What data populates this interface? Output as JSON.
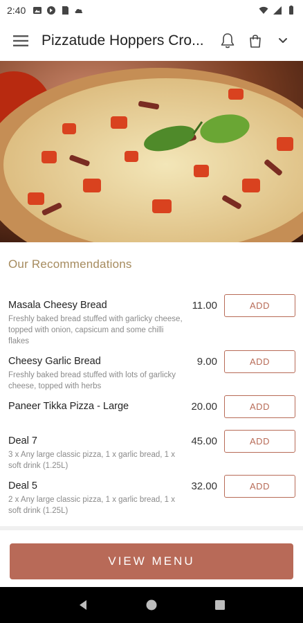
{
  "status_bar": {
    "time": "2:40"
  },
  "app_bar": {
    "title": "Pizzatude Hoppers Cro..."
  },
  "section": {
    "title": "Our Recommendations"
  },
  "items": [
    {
      "name": "Masala Cheesy Bread",
      "description": "Freshly baked bread stuffed with garlicky cheese, topped with onion, capsicum and some chilli flakes",
      "price": "11.00",
      "add_label": "ADD"
    },
    {
      "name": "Cheesy Garlic Bread",
      "description": "Freshly baked bread stuffed with lots of garlicky cheese, topped with herbs",
      "price": "9.00",
      "add_label": "ADD"
    },
    {
      "name": "Paneer Tikka Pizza - Large",
      "description": "",
      "price": "20.00",
      "add_label": "ADD"
    },
    {
      "name": "Deal 7",
      "description": "3 x Any large classic pizza, 1 x garlic bread, 1 x soft drink (1.25L)",
      "price": "45.00",
      "add_label": "ADD"
    },
    {
      "name": "Deal 5",
      "description": "2 x Any large classic pizza, 1 x garlic bread, 1 x soft drink (1.25L)",
      "price": "32.00",
      "add_label": "ADD"
    }
  ],
  "view_menu_label": "VIEW MENU",
  "colors": {
    "accent": "#b86a58",
    "section_title": "#a68b5e"
  },
  "icons": {
    "menu": "hamburger-icon",
    "bell": "bell-icon",
    "bag": "shopping-bag-icon",
    "chevron": "chevron-down-icon"
  }
}
